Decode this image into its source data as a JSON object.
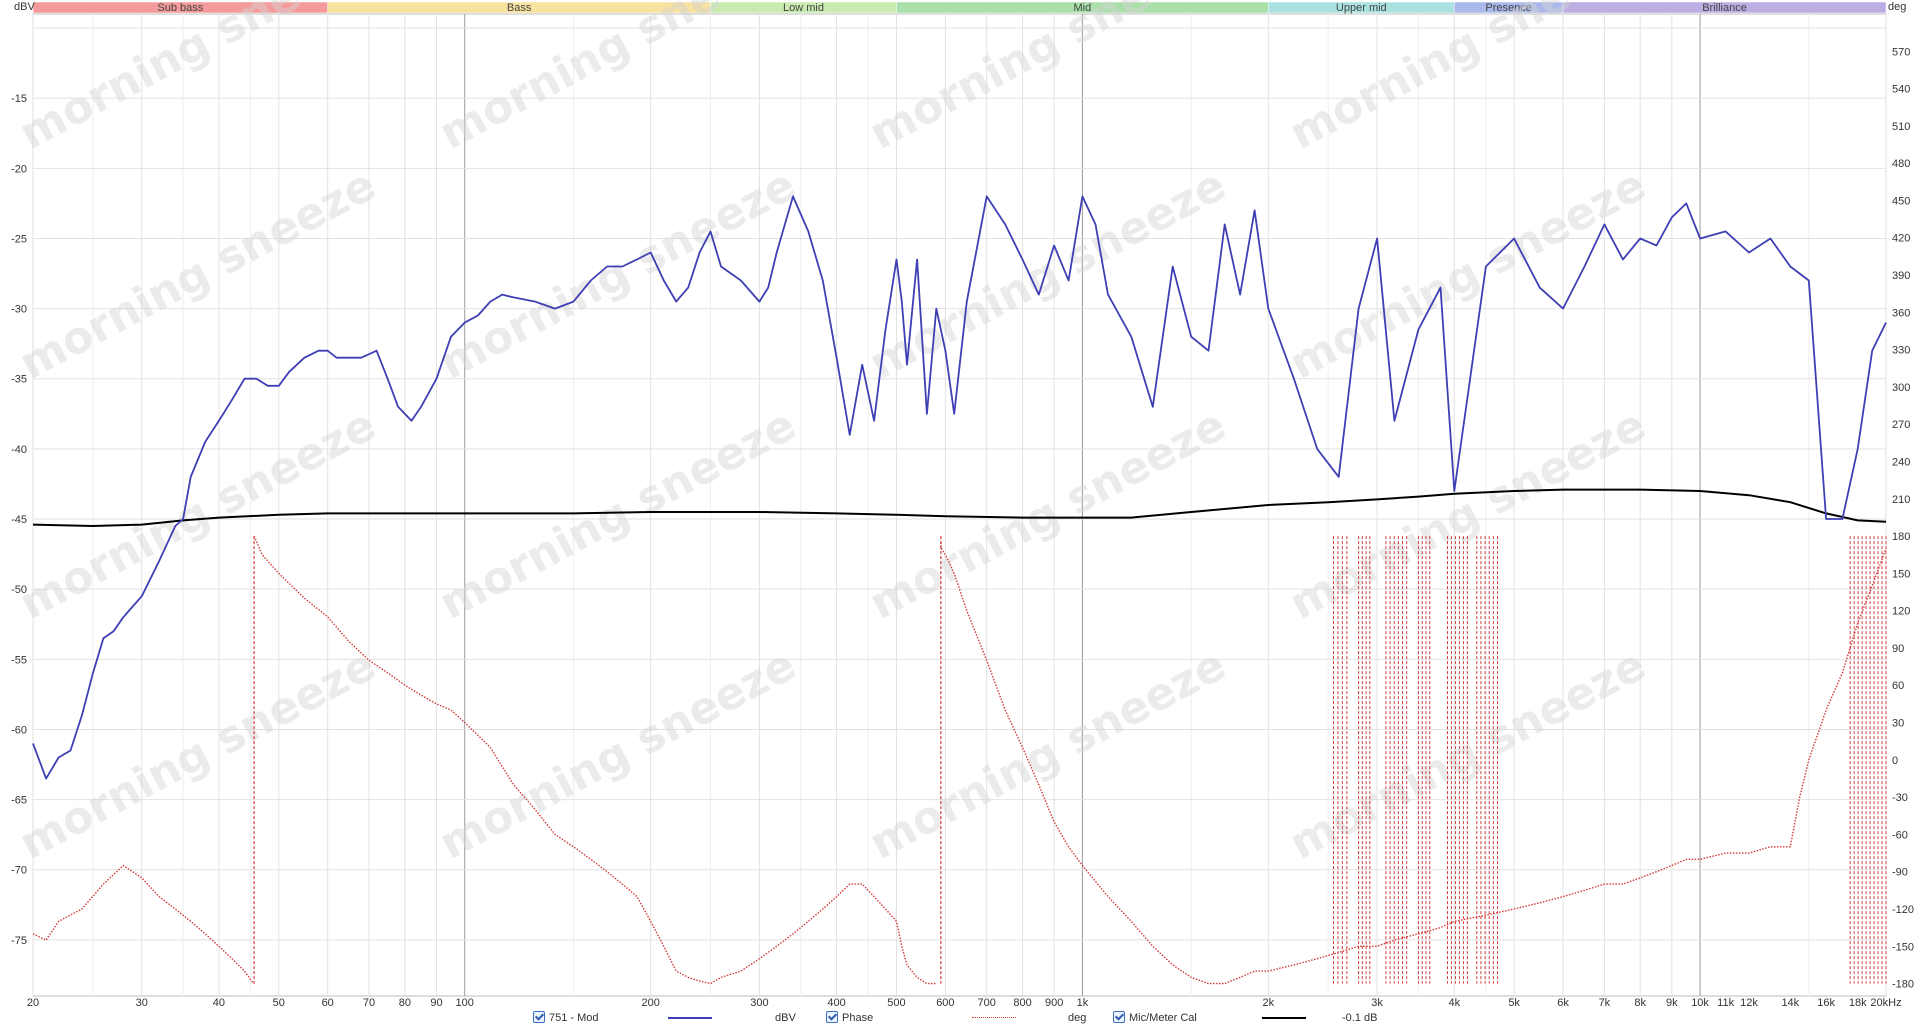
{
  "chart_data": {
    "type": "line",
    "title": "",
    "left_axis_unit": "dBV",
    "right_axis_unit": "deg",
    "xscale": "log",
    "xlim": [
      20,
      20000
    ],
    "ylim_left": [
      -79,
      -9
    ],
    "ylim_right": [
      -190,
      600
    ],
    "grid": true,
    "x_ticks": [
      {
        "v": 20,
        "label": "20"
      },
      {
        "v": 30,
        "label": "30"
      },
      {
        "v": 40,
        "label": "40"
      },
      {
        "v": 50,
        "label": "50"
      },
      {
        "v": 60,
        "label": "60"
      },
      {
        "v": 70,
        "label": "70"
      },
      {
        "v": 80,
        "label": "80"
      },
      {
        "v": 90,
        "label": "90"
      },
      {
        "v": 100,
        "label": "100"
      },
      {
        "v": 200,
        "label": "200"
      },
      {
        "v": 300,
        "label": "300"
      },
      {
        "v": 400,
        "label": "400"
      },
      {
        "v": 500,
        "label": "500"
      },
      {
        "v": 600,
        "label": "600"
      },
      {
        "v": 700,
        "label": "700"
      },
      {
        "v": 800,
        "label": "800"
      },
      {
        "v": 900,
        "label": "900"
      },
      {
        "v": 1000,
        "label": "1k"
      },
      {
        "v": 2000,
        "label": "2k"
      },
      {
        "v": 3000,
        "label": "3k"
      },
      {
        "v": 4000,
        "label": "4k"
      },
      {
        "v": 5000,
        "label": "5k"
      },
      {
        "v": 6000,
        "label": "6k"
      },
      {
        "v": 7000,
        "label": "7k"
      },
      {
        "v": 8000,
        "label": "8k"
      },
      {
        "v": 9000,
        "label": "9k"
      },
      {
        "v": 10000,
        "label": "10k"
      },
      {
        "v": 11000,
        "label": "11k"
      },
      {
        "v": 12000,
        "label": "12k"
      },
      {
        "v": 14000,
        "label": "14k"
      },
      {
        "v": 16000,
        "label": "16k"
      },
      {
        "v": 18000,
        "label": "18k"
      },
      {
        "v": 20000,
        "label": "20kHz"
      }
    ],
    "left_ticks": [
      -15,
      -20,
      -25,
      -30,
      -35,
      -40,
      -45,
      -50,
      -55,
      -60,
      -65,
      -70,
      -75
    ],
    "right_ticks": [
      570,
      540,
      510,
      480,
      450,
      420,
      390,
      360,
      330,
      300,
      270,
      240,
      210,
      180,
      150,
      120,
      90,
      60,
      30,
      0,
      -30,
      -60,
      -90,
      -120,
      -150,
      -180
    ],
    "bands": [
      {
        "label": "Sub bass",
        "from": 20,
        "to": 60,
        "color": "#f59a9a"
      },
      {
        "label": "Bass",
        "from": 60,
        "to": 250,
        "color": "#f7e2a0"
      },
      {
        "label": "Low mid",
        "from": 250,
        "to": 500,
        "color": "#c9ebb0"
      },
      {
        "label": "Mid",
        "from": 500,
        "to": 2000,
        "color": "#a9dfa9"
      },
      {
        "label": "Upper mid",
        "from": 2000,
        "to": 4000,
        "color": "#a9e2e0"
      },
      {
        "label": "Presence",
        "from": 4000,
        "to": 6000,
        "color": "#aab8ea"
      },
      {
        "label": "Brilliance",
        "from": 6000,
        "to": 20000,
        "color": "#bcaee2"
      }
    ],
    "series": [
      {
        "name": "751 - Mod",
        "unit": "dBV",
        "axis": "left",
        "color": "#3f3fb5",
        "x": [
          20,
          21,
          22,
          23,
          24,
          25,
          26,
          27,
          28,
          30,
          32,
          34,
          35,
          36,
          38,
          40,
          42,
          44,
          46,
          48,
          50,
          52,
          55,
          58,
          60,
          62,
          65,
          68,
          72,
          75,
          78,
          82,
          85,
          90,
          95,
          100,
          105,
          110,
          115,
          120,
          130,
          140,
          150,
          160,
          170,
          180,
          190,
          200,
          210,
          220,
          230,
          240,
          250,
          260,
          280,
          300,
          310,
          320,
          340,
          360,
          380,
          400,
          420,
          440,
          460,
          480,
          500,
          510,
          520,
          540,
          560,
          580,
          600,
          620,
          650,
          700,
          750,
          800,
          850,
          900,
          950,
          1000,
          1050,
          1100,
          1200,
          1300,
          1400,
          1500,
          1600,
          1700,
          1800,
          1900,
          2000,
          2200,
          2400,
          2600,
          2800,
          3000,
          3200,
          3500,
          3800,
          4000,
          4500,
          5000,
          5500,
          6000,
          6500,
          7000,
          7500,
          8000,
          8500,
          9000,
          9500,
          10000,
          11000,
          12000,
          13000,
          14000,
          15000,
          16000,
          17000,
          18000,
          19000,
          20000
        ],
        "y": [
          -61,
          -63.5,
          -62,
          -61.5,
          -59,
          -56,
          -53.5,
          -53,
          -52,
          -50.5,
          -48,
          -45.5,
          -45,
          -42,
          -39.5,
          -38,
          -36.5,
          -35,
          -35,
          -35.5,
          -35.5,
          -34.5,
          -33.5,
          -33,
          -33,
          -33.5,
          -33.5,
          -33.5,
          -33,
          -35,
          -37,
          -38,
          -37,
          -35,
          -32,
          -31,
          -30.5,
          -29.5,
          -29,
          -29.2,
          -29.5,
          -30,
          -29.5,
          -28,
          -27,
          -27,
          -26.5,
          -26,
          -28,
          -29.5,
          -28.5,
          -26,
          -24.5,
          -27,
          -28,
          -29.5,
          -28.5,
          -26,
          -22,
          -24.5,
          -28,
          -33.5,
          -39,
          -34,
          -38,
          -31.5,
          -26.5,
          -29.5,
          -34,
          -26.5,
          -37.5,
          -30,
          -33,
          -37.5,
          -29.5,
          -22,
          -24,
          -26.5,
          -29,
          -25.5,
          -28,
          -22,
          -24,
          -29,
          -32,
          -37,
          -27,
          -32,
          -33,
          -24,
          -29,
          -23,
          -30,
          -35,
          -40,
          -42,
          -30,
          -25,
          -38,
          -31.5,
          -28.5,
          -43,
          -27,
          -25,
          -28.5,
          -30,
          -27,
          -24,
          -26.5,
          -25,
          -25.5,
          -23.5,
          -22.5,
          -25,
          -24.5,
          -26,
          -25,
          -27,
          -28,
          -45,
          -45,
          -40,
          -33,
          -31
        ]
      },
      {
        "name": "Phase",
        "unit": "deg",
        "axis": "right",
        "color": "#d43a3a",
        "x": [
          20,
          21,
          22,
          24,
          26,
          28,
          30,
          32,
          34,
          36,
          38,
          40,
          42,
          44,
          45.5,
          45.6,
          47,
          50,
          55,
          60,
          65,
          70,
          75,
          80,
          85,
          90,
          95,
          100,
          110,
          120,
          130,
          140,
          150,
          160,
          170,
          180,
          190,
          200,
          210,
          220,
          230,
          240,
          250,
          260,
          280,
          300,
          320,
          340,
          360,
          380,
          400,
          420,
          440,
          460,
          480,
          500,
          510,
          520,
          540,
          560,
          580,
          590,
          591,
          600,
          620,
          650,
          700,
          750,
          800,
          850,
          900,
          950,
          1000,
          1100,
          1200,
          1300,
          1400,
          1500,
          1600,
          1700,
          1800,
          1900,
          2000,
          2200,
          2400,
          2600,
          2800,
          3000,
          3200,
          3500,
          3800,
          4000,
          4500,
          5000,
          5500,
          6000,
          6500,
          7000,
          7500,
          8000,
          8500,
          9000,
          9500,
          10000,
          11000,
          12000,
          13000,
          14000,
          14500,
          15000,
          16000,
          17000,
          18000,
          19000,
          20000
        ],
        "y": [
          -140,
          -145,
          -130,
          -120,
          -100,
          -85,
          -95,
          -110,
          -120,
          -130,
          -140,
          -150,
          -160,
          -170,
          -180,
          180,
          165,
          150,
          130,
          115,
          95,
          80,
          70,
          60,
          52,
          45,
          40,
          30,
          10,
          -20,
          -40,
          -60,
          -70,
          -80,
          -90,
          -100,
          -110,
          -130,
          -150,
          -170,
          -175,
          -178,
          -180,
          -175,
          -170,
          -160,
          -150,
          -140,
          -130,
          -120,
          -110,
          -100,
          -100,
          -110,
          -120,
          -130,
          -150,
          -165,
          -175,
          -180,
          -180,
          175,
          170,
          165,
          150,
          120,
          80,
          40,
          10,
          -20,
          -50,
          -70,
          -85,
          -110,
          -130,
          -150,
          -165,
          -175,
          -180,
          -180,
          -175,
          -170,
          -170,
          -165,
          -160,
          -155,
          -150,
          -150,
          -145,
          -140,
          -135,
          -130,
          -125,
          -120,
          -115,
          -110,
          -105,
          -100,
          -100,
          -95,
          -90,
          -85,
          -80,
          -80,
          -75,
          -75,
          -70,
          -70,
          -30,
          0,
          40,
          70,
          110,
          140,
          170
        ]
      },
      {
        "name": "Mic/Meter Cal",
        "unit": "-0.1 dB",
        "axis": "left",
        "color": "#000000",
        "x": [
          20,
          25,
          30,
          35,
          40,
          50,
          60,
          80,
          100,
          150,
          200,
          300,
          400,
          500,
          600,
          800,
          1000,
          1200,
          1500,
          2000,
          2500,
          3000,
          3500,
          4000,
          5000,
          6000,
          7000,
          8000,
          10000,
          12000,
          14000,
          16000,
          18000,
          20000
        ],
        "y": [
          -45.4,
          -45.5,
          -45.4,
          -45.1,
          -44.9,
          -44.7,
          -44.6,
          -44.6,
          -44.6,
          -44.6,
          -44.5,
          -44.5,
          -44.6,
          -44.7,
          -44.8,
          -44.9,
          -44.9,
          -44.9,
          -44.5,
          -44.0,
          -43.8,
          -43.6,
          -43.4,
          -43.2,
          -43.0,
          -42.9,
          -42.9,
          -42.9,
          -43.0,
          -43.3,
          -43.8,
          -44.6,
          -45.1,
          -45.2
        ]
      }
    ],
    "phase_wrap_regions": [
      {
        "from": 2550,
        "to": 2680
      },
      {
        "from": 2800,
        "to": 2920
      },
      {
        "from": 3100,
        "to": 3350
      },
      {
        "from": 3500,
        "to": 3650
      },
      {
        "from": 3900,
        "to": 4200
      },
      {
        "from": 4350,
        "to": 4700
      },
      {
        "from": 17500,
        "to": 20000
      }
    ]
  },
  "legend": [
    {
      "label": "751 - Mod",
      "unit": "dBV",
      "color": "#3f3fb5",
      "style": "solid"
    },
    {
      "label": "Phase",
      "unit": "deg",
      "color": "#d43a3a",
      "style": "dotted"
    },
    {
      "label": "Mic/Meter Cal",
      "unit": "-0.1 dB",
      "color": "#000000",
      "style": "solid"
    }
  ],
  "watermark": "morning sneeze"
}
